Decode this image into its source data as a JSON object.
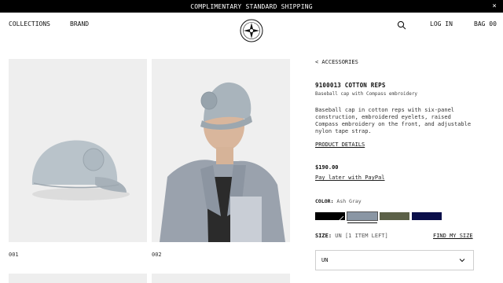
{
  "promo": {
    "text": "COMPLIMENTARY STANDARD SHIPPING",
    "close": "×"
  },
  "nav": {
    "collections": "COLLECTIONS",
    "brand": "BRAND",
    "login": "LOG IN",
    "bag": "BAG 00"
  },
  "gallery": {
    "labels": [
      "001",
      "002"
    ]
  },
  "product": {
    "breadcrumb": "< ACCESSORIES",
    "title": "9100013 COTTON REPS",
    "subtitle": "Baseball cap with Compass embroidery",
    "description": "Baseball cap in cotton reps with six-panel construction, embroidered eyelets, raised Compass embroidery on the front, and adjustable nylon tape strap.",
    "details_link": "PRODUCT DETAILS",
    "price": "$190.00",
    "paypal": "Pay later with PayPal",
    "color_label": "COLOR:",
    "color_value": "Ash Gray",
    "swatches": [
      "#000000",
      "#8a96a4",
      "#5c6148",
      "#0b0f4a"
    ],
    "size_label": "SIZE:",
    "size_value": "UN [1 ITEM LEFT]",
    "find_size": "FIND MY SIZE",
    "size_selected": "UN"
  }
}
